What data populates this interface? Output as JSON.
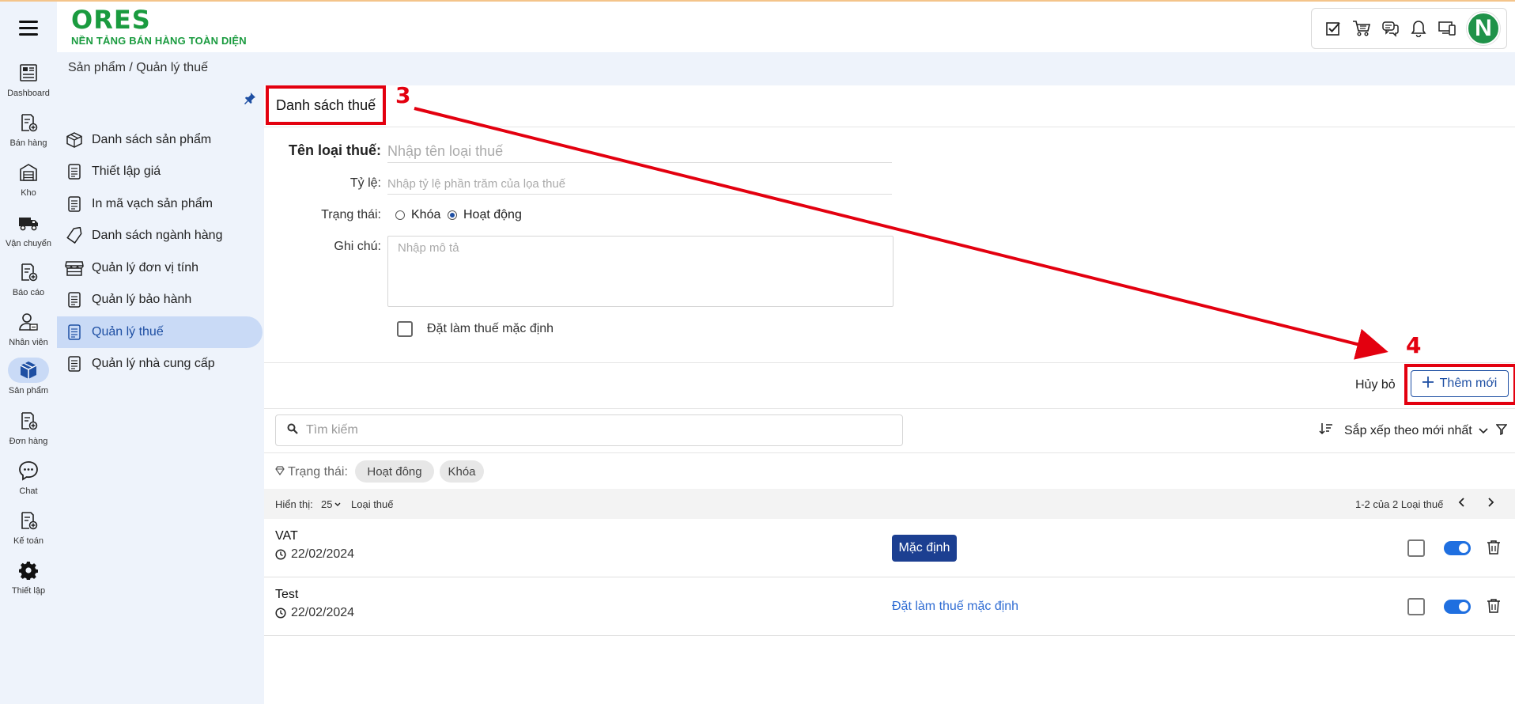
{
  "app": {
    "logo_title": "ORES",
    "logo_subtitle": "NỀN TẢNG BÁN HÀNG TOÀN DIỆN",
    "avatar_initial": "N",
    "accent_color": "#1e4fa3",
    "brand_color": "#1a9b3f"
  },
  "rail": [
    {
      "label": "Dashboard",
      "icon": "dashboard-icon"
    },
    {
      "label": "Bán hàng",
      "icon": "sales-icon"
    },
    {
      "label": "Kho",
      "icon": "warehouse-icon"
    },
    {
      "label": "Vận chuyển",
      "icon": "truck-icon"
    },
    {
      "label": "Báo cáo",
      "icon": "report-icon"
    },
    {
      "label": "Nhân viên",
      "icon": "staff-icon"
    },
    {
      "label": "Sản phẩm",
      "icon": "box-icon",
      "active": true
    },
    {
      "label": "Đơn hàng",
      "icon": "order-icon"
    },
    {
      "label": "Chat",
      "icon": "chat-icon"
    },
    {
      "label": "Kế toán",
      "icon": "accounting-icon"
    },
    {
      "label": "Thiết lập",
      "icon": "gear-icon"
    }
  ],
  "breadcrumb": "Sản phẩm / Quản lý thuế",
  "submenu": [
    {
      "label": "Danh sách sản phẩm",
      "icon": "package-icon"
    },
    {
      "label": "Thiết lập giá",
      "icon": "document-icon"
    },
    {
      "label": "In mã vạch sản phẩm",
      "icon": "document-icon"
    },
    {
      "label": "Danh sách ngành hàng",
      "icon": "tag-icon"
    },
    {
      "label": "Quản lý đơn vị tính",
      "icon": "store-icon"
    },
    {
      "label": "Quản lý bảo hành",
      "icon": "document-icon"
    },
    {
      "label": "Quản lý thuế",
      "icon": "document-icon",
      "active": true
    },
    {
      "label": "Quản lý nhà cung cấp",
      "icon": "document-icon"
    }
  ],
  "form": {
    "section_title": "Danh sách thuế",
    "annotation_step_3": "3",
    "annotation_step_4": "4",
    "name_label": "Tên loại thuế:",
    "name_placeholder": "Nhập tên loại thuế",
    "rate_label": "Tỷ lệ:",
    "rate_placeholder": "Nhập tỷ lệ phần trăm của lọa thuế",
    "status_label": "Trạng thái:",
    "status_options": [
      "Khóa",
      "Hoạt động"
    ],
    "status_selected": "Hoạt động",
    "note_label": "Ghi chú:",
    "note_placeholder": "Nhập mô tả",
    "default_checkbox_label": "Đặt làm thuế mặc định",
    "cancel_label": "Hủy bỏ",
    "add_label": "Thêm mới"
  },
  "list": {
    "search_placeholder": "Tìm kiếm",
    "sort_label": "Sắp xếp theo mới nhất",
    "filter_status_label": "Trạng thái:",
    "filter_chips": [
      "Hoạt đông",
      "Khóa"
    ],
    "show_label": "Hiển thị:",
    "page_size": "25",
    "type_label": "Loại thuế",
    "range_label": "1-2 của 2 Loại thuế",
    "rows": [
      {
        "name": "VAT",
        "date": "22/02/2024",
        "default_badge": "Mặc định",
        "is_default": true,
        "active": true
      },
      {
        "name": "Test",
        "date": "22/02/2024",
        "set_default_link": "Đặt làm thuế mặc định",
        "is_default": false,
        "active": true
      }
    ]
  }
}
